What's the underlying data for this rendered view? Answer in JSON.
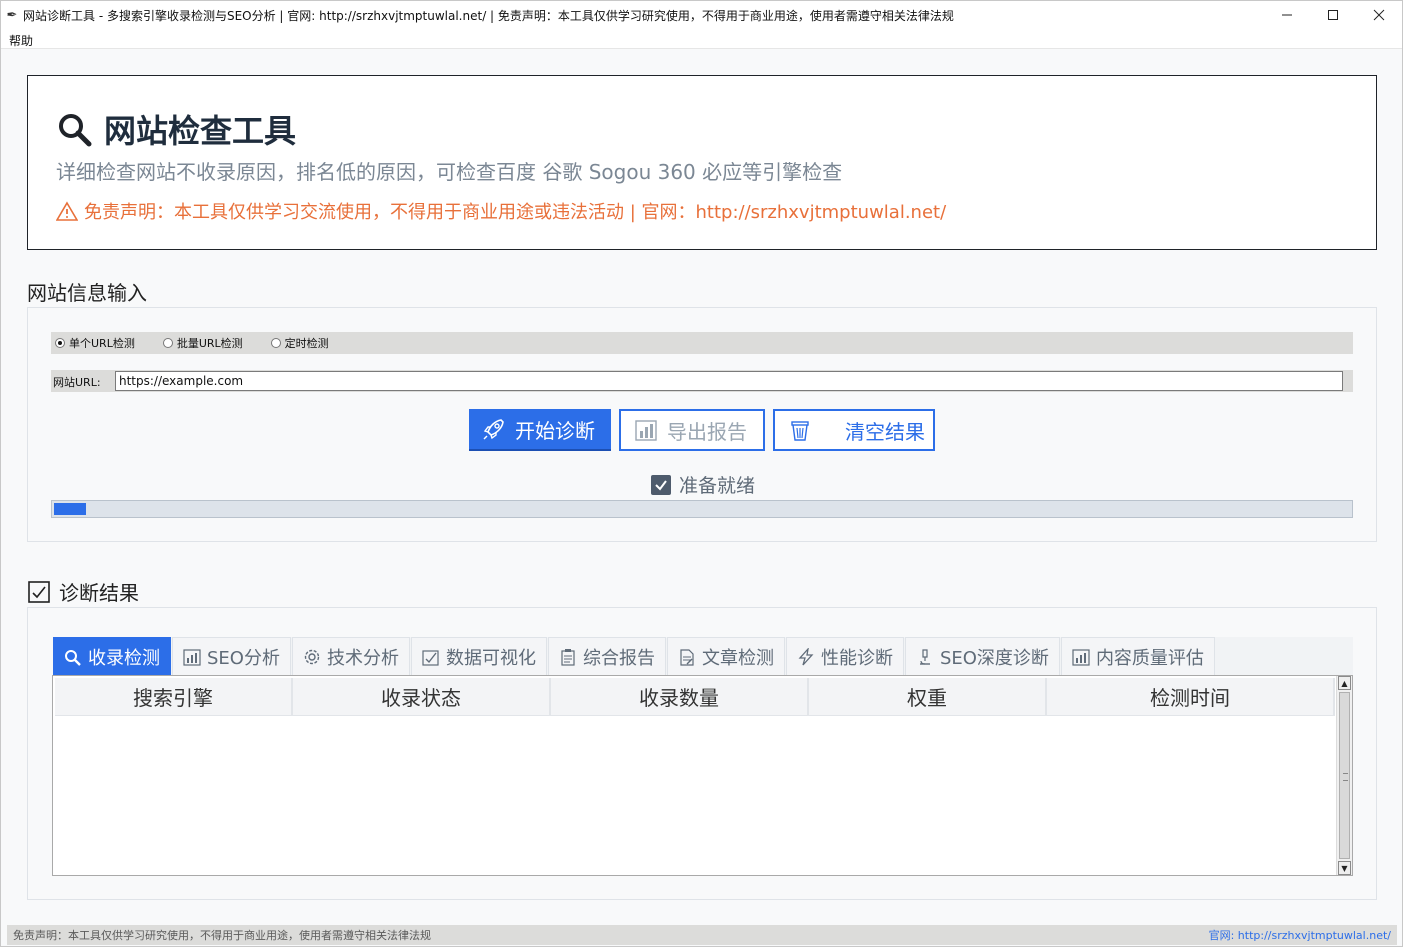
{
  "window": {
    "title": "网站诊断工具 - 多搜索引擎收录检测与SEO分析 | 官网: http://srzhxvjtmptuwlal.net/ | 免责声明：本工具仅供学习研究使用，不得用于商业用途，使用者需遵守相关法律法规",
    "minimize_icon": "minimize-icon",
    "maximize_icon": "maximize-icon",
    "close_icon": "close-icon"
  },
  "menu": {
    "help": "帮助"
  },
  "header": {
    "title": "网站检查工具",
    "subtitle": "详细检查网站不收录原因，排名低的原因，可检查百度 谷歌 Sogou 360 必应等引擎检查",
    "disclaimer": "免责声明：本工具仅供学习交流使用，不得用于商业用途或违法活动 | 官网：http://srzhxvjtmptuwlal.net/",
    "title_color": "#1f2d3d",
    "disclaimer_color": "#e8703a"
  },
  "input_section": {
    "label": "网站信息输入",
    "modes": [
      {
        "label": "单个URL检测",
        "selected": true
      },
      {
        "label": "批量URL检测",
        "selected": false
      },
      {
        "label": "定时检测",
        "selected": false
      }
    ],
    "url_label": "网站URL:",
    "url_value": "https://example.com",
    "buttons": {
      "start": "开始诊断",
      "export": "导出报告",
      "clear": "清空结果"
    },
    "status": "准备就绪",
    "progress": 0.025,
    "accent_color": "#2c6ee8"
  },
  "results_section": {
    "label": "诊断结果",
    "tabs": [
      {
        "label": "收录检测",
        "icon": "search-icon",
        "active": true
      },
      {
        "label": "SEO分析",
        "icon": "bar-chart-icon",
        "active": false
      },
      {
        "label": "技术分析",
        "icon": "gear-icon",
        "active": false
      },
      {
        "label": "数据可视化",
        "icon": "checkbox-chart-icon",
        "active": false
      },
      {
        "label": "综合报告",
        "icon": "clipboard-icon",
        "active": false
      },
      {
        "label": "文章检测",
        "icon": "document-icon",
        "active": false
      },
      {
        "label": "性能诊断",
        "icon": "lightning-icon",
        "active": false
      },
      {
        "label": "SEO深度诊断",
        "icon": "microscope-icon",
        "active": false
      },
      {
        "label": "内容质量评估",
        "icon": "bar-chart-icon",
        "active": false
      }
    ],
    "columns": [
      "搜索引擎",
      "收录状态",
      "收录数量",
      "权重",
      "检测时间"
    ]
  },
  "footer": {
    "left": "免责声明：本工具仅供学习研究使用，不得用于商业用途，使用者需遵守相关法律法规",
    "right": "官网: http://srzhxvjtmptuwlal.net/"
  }
}
